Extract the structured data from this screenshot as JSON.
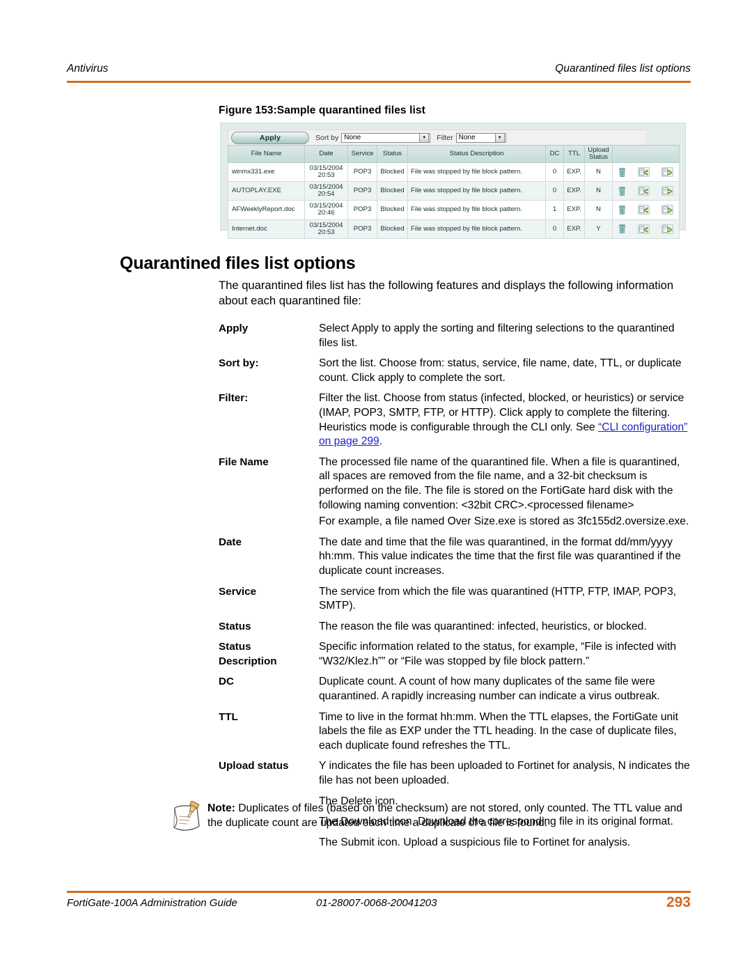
{
  "header": {
    "left": "Antivirus",
    "right": "Quarantined files list options",
    "rule_color": "#d2691e"
  },
  "figure": {
    "caption": "Figure 153:Sample quarantined files list",
    "toolbar": {
      "apply_label": "Apply",
      "sort_by_label": "Sort by",
      "sort_by_value": "None",
      "filter_label": "Filter",
      "filter_value": "None"
    },
    "table": {
      "columns": [
        "File Name",
        "Date",
        "Service",
        "Status",
        "Status Description",
        "DC",
        "TTL",
        "Upload Status"
      ],
      "upload_status_line1": "Upload",
      "upload_status_line2": "Status",
      "rows": [
        {
          "file_name": "winmx331.exe",
          "date_line1": "03/15/2004",
          "date_line2": "20:53",
          "service": "POP3",
          "status": "Blocked",
          "status_description": "File was stopped by file block pattern.",
          "dc": "0",
          "ttl": "EXP.",
          "upload_status": "N"
        },
        {
          "file_name": "AUTOPLAY.EXE",
          "date_line1": "03/15/2004",
          "date_line2": "20:54",
          "service": "POP3",
          "status": "Blocked",
          "status_description": "File was stopped by file block pattern.",
          "dc": "0",
          "ttl": "EXP.",
          "upload_status": "N"
        },
        {
          "file_name": "AFWeeklyReport.doc",
          "date_line1": "03/15/2004",
          "date_line2": "20:46",
          "service": "POP3",
          "status": "Blocked",
          "status_description": "File was stopped by file block pattern.",
          "dc": "1",
          "ttl": "EXP.",
          "upload_status": "N"
        },
        {
          "file_name": "Internet.doc",
          "date_line1": "03/15/2004",
          "date_line2": "20:53",
          "service": "POP3",
          "status": "Blocked",
          "status_description": "File was stopped by file block pattern.",
          "dc": "0",
          "ttl": "EXP.",
          "upload_status": "Y"
        }
      ]
    }
  },
  "section": {
    "heading": "Quarantined files list options",
    "intro": "The quarantined files list has the following features and displays the following information about each quarantined file:"
  },
  "definitions": [
    {
      "term": "Apply",
      "desc": "Select Apply to apply the sorting and filtering selections to the quarantined files list."
    },
    {
      "term": "Sort by:",
      "desc": "Sort the list. Choose from: status, service, file name, date, TTL, or duplicate count. Click apply to complete the sort."
    },
    {
      "term": "Filter:",
      "desc_before_link": "Filter the list. Choose from status (infected, blocked, or heuristics) or service (IMAP, POP3, SMTP, FTP, or HTTP). Click apply to complete the filtering. Heuristics mode is configurable through the CLI only. See ",
      "link_text": "“CLI configuration” on page 299",
      "desc_after_link": "."
    },
    {
      "term": "File Name",
      "desc": "The processed file name of the quarantined file. When a file is quarantined, all spaces are removed from the file name, and a 32-bit checksum is performed on the file. The file is stored on the FortiGate hard disk with the following naming convention: <32bit CRC>.<processed filename>",
      "desc2": "For example, a file named Over Size.exe is stored as 3fc155d2.oversize.exe."
    },
    {
      "term": "Date",
      "desc": "The date and time that the file was quarantined, in the format dd/mm/yyyy hh:mm. This value indicates the time that the first file was quarantined if the duplicate count increases."
    },
    {
      "term": "Service",
      "desc": "The service from which the file was quarantined (HTTP, FTP, IMAP, POP3, SMTP)."
    },
    {
      "term": "Status",
      "desc": "The reason the file was quarantined: infected, heuristics, or blocked."
    },
    {
      "term": "Status",
      "term2": "Description",
      "desc": "Specific information related to the status, for example, “File is infected with “W32/Klez.h”” or “File was stopped by file block pattern.”"
    },
    {
      "term": "DC",
      "desc": "Duplicate count. A count of how many duplicates of the same file were quarantined. A rapidly increasing number can indicate a virus outbreak."
    },
    {
      "term": "TTL",
      "desc": "Time to live in the format hh:mm. When the TTL elapses, the FortiGate unit labels the file as EXP under the TTL heading. In the case of duplicate files, each duplicate found refreshes the TTL."
    },
    {
      "term": "Upload status",
      "desc": "Y indicates the file has been uploaded to Fortinet for analysis, N indicates the file has not been uploaded."
    }
  ],
  "icon_descriptions": [
    "The Delete icon.",
    "The Download icon. Download the corresponding file in its original format.",
    "The Submit icon. Upload a suspicious file to Fortinet for analysis."
  ],
  "note": {
    "label": "Note:",
    "text": " Duplicates of files (based on the checksum) are not stored, only counted. The TTL value and the duplicate count are updated each time a duplicate of a file is found."
  },
  "footer": {
    "guide": "FortiGate-100A Administration Guide",
    "doc_id": "01-28007-0068-20041203",
    "page_number": "293",
    "accent_color": "#d2691e"
  }
}
